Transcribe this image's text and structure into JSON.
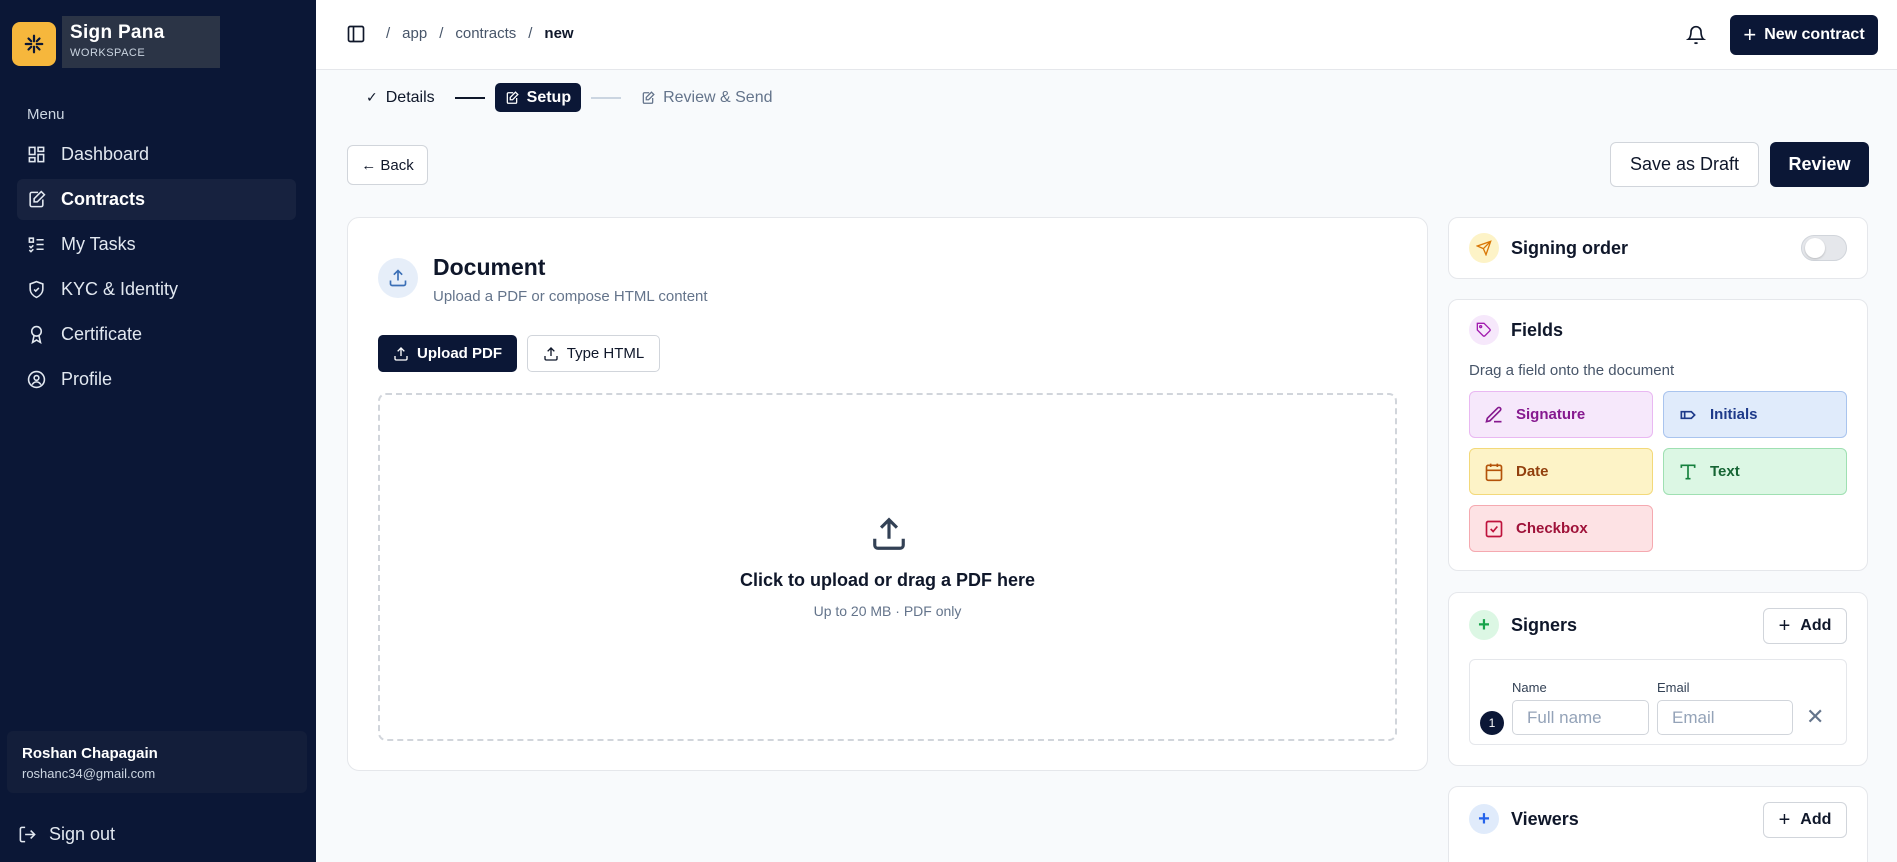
{
  "brand": {
    "name": "Sign Pana",
    "subtitle": "WORKSPACE"
  },
  "sidebar": {
    "menu_label": "Menu",
    "items": [
      {
        "label": "Dashboard",
        "icon": "dashboard-icon"
      },
      {
        "label": "Contracts",
        "icon": "contract-icon",
        "active": true
      },
      {
        "label": "My Tasks",
        "icon": "tasks-icon"
      },
      {
        "label": "KYC & Identity",
        "icon": "shield-icon"
      },
      {
        "label": "Certificate",
        "icon": "certificate-icon"
      },
      {
        "label": "Profile",
        "icon": "profile-icon"
      }
    ],
    "user": {
      "name": "Roshan Chapagain",
      "email": "roshanc34@gmail.com"
    },
    "signout_label": "Sign out"
  },
  "header": {
    "breadcrumb": [
      "/",
      "app",
      "/",
      "contracts",
      "/",
      "new"
    ],
    "new_contract_label": "New contract"
  },
  "stepper": {
    "steps": [
      {
        "label": "Details",
        "state": "done"
      },
      {
        "label": "Setup",
        "state": "active"
      },
      {
        "label": "Review & Send",
        "state": "upcoming"
      }
    ]
  },
  "actions": {
    "back_label": "← Back",
    "draft_label": "Save as Draft",
    "review_label": "Review"
  },
  "document": {
    "title": "Document",
    "subtitle": "Upload a PDF or compose HTML content",
    "upload_pdf_label": "Upload PDF",
    "type_html_label": "Type HTML",
    "drop_title": "Click to upload or drag a PDF here",
    "drop_sub": "Up to 20 MB · PDF only"
  },
  "signing_order": {
    "label": "Signing order",
    "enabled": false
  },
  "fields": {
    "title": "Fields",
    "hint": "Drag a field onto the document",
    "items": [
      {
        "label": "Signature",
        "icon": "pen-icon"
      },
      {
        "label": "Initials",
        "icon": "initials-icon"
      },
      {
        "label": "Date",
        "icon": "calendar-icon"
      },
      {
        "label": "Text",
        "icon": "text-icon"
      },
      {
        "label": "Checkbox",
        "icon": "checkbox-icon"
      }
    ]
  },
  "signers": {
    "title": "Signers",
    "add_label": "Add",
    "rows": [
      {
        "number": "1",
        "name_label": "Name",
        "name_placeholder": "Full name",
        "email_label": "Email",
        "email_placeholder": "Email"
      }
    ]
  },
  "viewers": {
    "title": "Viewers",
    "add_label": "Add"
  },
  "colors": {
    "navy": "#0b1736",
    "signature_bg": "#f6e8fb",
    "initials_bg": "#e0ebfb",
    "date_bg": "#fdf3c7",
    "text_bg": "#dcf7e4",
    "checkbox_bg": "#fde2e4"
  }
}
